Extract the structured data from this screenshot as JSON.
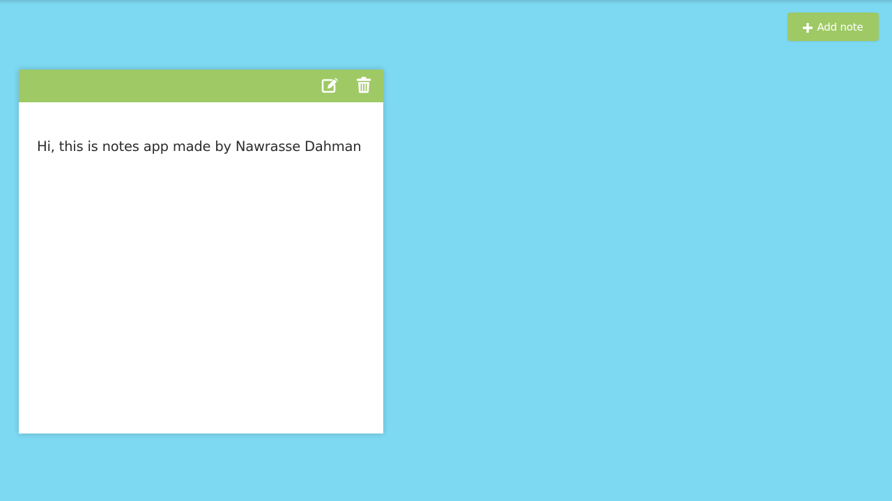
{
  "toolbar": {
    "add_note_label": "Add note",
    "add_note_icon": "plus-icon",
    "accent_color": "#9ec964"
  },
  "background_color": "#7dd8f1",
  "notes": [
    {
      "text": "Hi, this is notes app made by Nawrasse Dahman",
      "actions": [
        {
          "name": "edit",
          "icon": "edit-icon"
        },
        {
          "name": "delete",
          "icon": "trash-icon"
        }
      ]
    }
  ]
}
